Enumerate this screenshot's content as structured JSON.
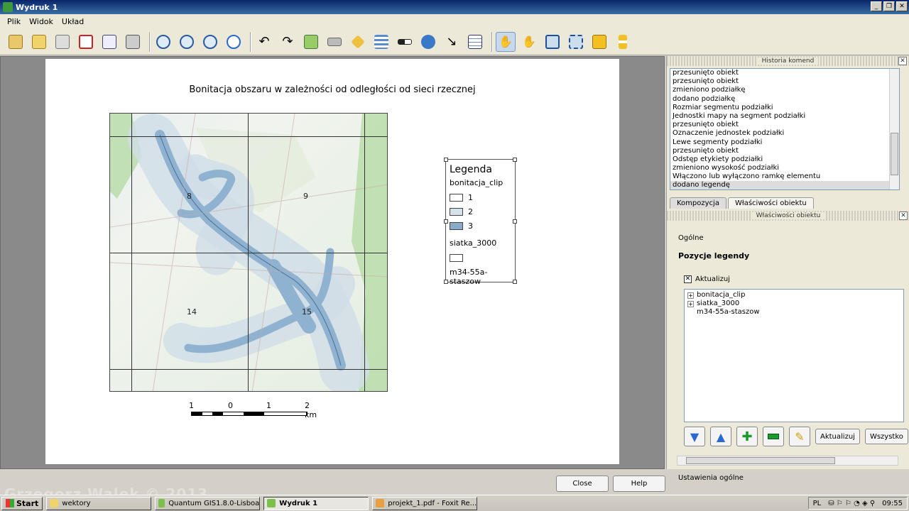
{
  "window": {
    "title": "Wydruk 1"
  },
  "menu": [
    "Plik",
    "Widok",
    "Układ"
  ],
  "toolbar_icons": [
    "folder-open-icon",
    "save-template-icon",
    "export-image-icon",
    "export-pdf-icon",
    "export-svg-icon",
    "print-icon",
    "zoom-full-icon",
    "zoom-in-icon",
    "zoom-out-icon",
    "refresh-icon",
    "undo-icon",
    "redo-icon",
    "add-map-icon",
    "add-image-icon",
    "add-label-icon",
    "add-legend-icon",
    "add-scalebar-icon",
    "add-shape-icon",
    "add-arrow-icon",
    "add-table-icon",
    "select-move-icon",
    "move-content-icon",
    "group-icon",
    "ungroup-icon",
    "raise-icon",
    "align-icon"
  ],
  "map": {
    "title": "Bonitacja obszaru w zależności od odległości od sieci rzecznej",
    "labels": [
      "8",
      "9",
      "14",
      "15"
    ]
  },
  "scalebar": {
    "ticks": [
      "1",
      "0",
      "1",
      "2 km"
    ]
  },
  "legend": {
    "title": "Legenda",
    "layer1": "bonitacja_clip",
    "classes": [
      {
        "label": "1",
        "color": "#ffffff"
      },
      {
        "label": "2",
        "color": "#d6e2ea"
      },
      {
        "label": "3",
        "color": "#8aabc9"
      }
    ],
    "layer2": "siatka_3000",
    "layer3": "m34-55a-staszow"
  },
  "history": {
    "title": "Historia komend",
    "items": [
      "przesunięto obiekt",
      "przesunięto obiekt",
      "zmieniono podziałkę",
      "dodano podziałkę",
      "Rozmiar segmentu podziałki",
      "Jednostki mapy na segment podziałki",
      "przesunięto obiekt",
      "Oznaczenie jednostek podziałki",
      "Lewe segmenty podziałki",
      "przesunięto obiekt",
      "Odstęp etykiety podziałki",
      "zmieniono wysokość podziałki",
      "Włączono lub wyłączono ramkę elementu",
      "dodano legendę"
    ]
  },
  "tabs": [
    "Kompozycja",
    "Właściwości obiektu"
  ],
  "props": {
    "title": "Właściwości obiektu",
    "section_general": "Ogólne",
    "section_items": "Pozycje legendy",
    "update_checkbox": "Aktualizuj",
    "tree": [
      "bonitacja_clip",
      "siatka_3000",
      "m34-55a-staszow"
    ],
    "btn_update": "Aktualizuj",
    "btn_all": "Wszystko",
    "general_settings": "Ustawienia ogólne"
  },
  "footer": {
    "close": "Close",
    "help": "Help"
  },
  "taskbar": {
    "start": "Start",
    "tasks": [
      "wektory",
      "Quantum GIS1.8.0-Lisboa",
      "Wydruk 1",
      "projekt_1.pdf - Foxit Re..."
    ],
    "lang": "PL",
    "clock": "09:55"
  },
  "watermark": "Grzegorz Walek © 2013"
}
